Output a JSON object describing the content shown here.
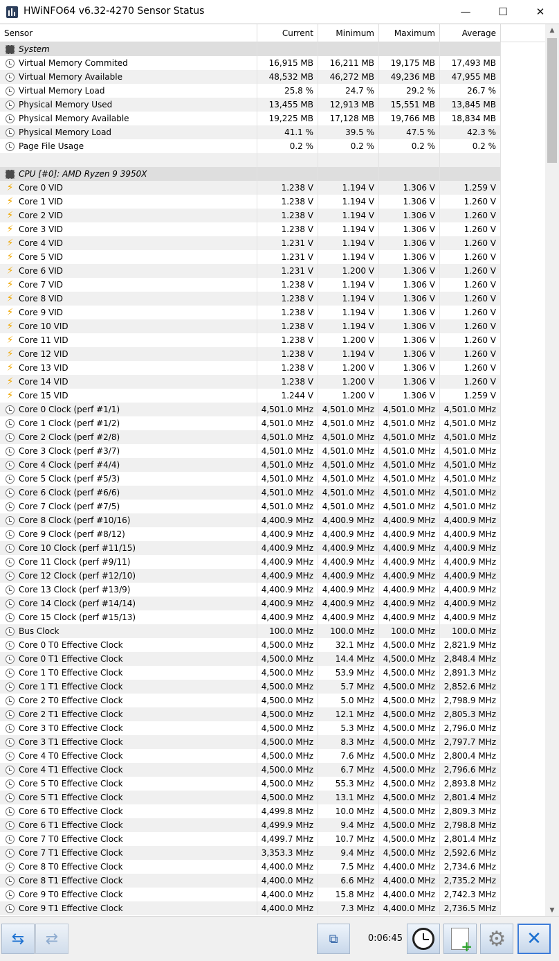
{
  "window": {
    "title": "HWiNFO64 v6.32-4270 Sensor Status",
    "minimize_glyph": "—",
    "maximize_glyph": "☐",
    "close_glyph": "✕"
  },
  "columns": {
    "sensor": "Sensor",
    "current": "Current",
    "minimum": "Minimum",
    "maximum": "Maximum",
    "average": "Average"
  },
  "rows": [
    {
      "type": "group",
      "icon": "chip-icon",
      "name": "System"
    },
    {
      "type": "sensor",
      "icon": "clock-icon",
      "name": "Virtual Memory Commited",
      "cur": "16,915 MB",
      "min": "16,211 MB",
      "max": "19,175 MB",
      "avg": "17,493 MB"
    },
    {
      "type": "sensor",
      "icon": "clock-icon",
      "name": "Virtual Memory Available",
      "cur": "48,532 MB",
      "min": "46,272 MB",
      "max": "49,236 MB",
      "avg": "47,955 MB"
    },
    {
      "type": "sensor",
      "icon": "clock-icon",
      "name": "Virtual Memory Load",
      "cur": "25.8 %",
      "min": "24.7 %",
      "max": "29.2 %",
      "avg": "26.7 %"
    },
    {
      "type": "sensor",
      "icon": "clock-icon",
      "name": "Physical Memory Used",
      "cur": "13,455 MB",
      "min": "12,913 MB",
      "max": "15,551 MB",
      "avg": "13,845 MB"
    },
    {
      "type": "sensor",
      "icon": "clock-icon",
      "name": "Physical Memory Available",
      "cur": "19,225 MB",
      "min": "17,128 MB",
      "max": "19,766 MB",
      "avg": "18,834 MB"
    },
    {
      "type": "sensor",
      "icon": "clock-icon",
      "name": "Physical Memory Load",
      "cur": "41.1 %",
      "min": "39.5 %",
      "max": "47.5 %",
      "avg": "42.3 %"
    },
    {
      "type": "sensor",
      "icon": "clock-icon",
      "name": "Page File Usage",
      "cur": "0.2 %",
      "min": "0.2 %",
      "max": "0.2 %",
      "avg": "0.2 %"
    },
    {
      "type": "blank"
    },
    {
      "type": "group",
      "icon": "chip-icon",
      "name": "CPU [#0]: AMD Ryzen 9 3950X"
    },
    {
      "type": "sensor",
      "icon": "voltage-icon",
      "name": "Core 0 VID",
      "cur": "1.238 V",
      "min": "1.194 V",
      "max": "1.306 V",
      "avg": "1.259 V"
    },
    {
      "type": "sensor",
      "icon": "voltage-icon",
      "name": "Core 1 VID",
      "cur": "1.238 V",
      "min": "1.194 V",
      "max": "1.306 V",
      "avg": "1.260 V"
    },
    {
      "type": "sensor",
      "icon": "voltage-icon",
      "name": "Core 2 VID",
      "cur": "1.238 V",
      "min": "1.194 V",
      "max": "1.306 V",
      "avg": "1.260 V"
    },
    {
      "type": "sensor",
      "icon": "voltage-icon",
      "name": "Core 3 VID",
      "cur": "1.238 V",
      "min": "1.194 V",
      "max": "1.306 V",
      "avg": "1.260 V"
    },
    {
      "type": "sensor",
      "icon": "voltage-icon",
      "name": "Core 4 VID",
      "cur": "1.231 V",
      "min": "1.194 V",
      "max": "1.306 V",
      "avg": "1.260 V"
    },
    {
      "type": "sensor",
      "icon": "voltage-icon",
      "name": "Core 5 VID",
      "cur": "1.231 V",
      "min": "1.194 V",
      "max": "1.306 V",
      "avg": "1.260 V"
    },
    {
      "type": "sensor",
      "icon": "voltage-icon",
      "name": "Core 6 VID",
      "cur": "1.231 V",
      "min": "1.200 V",
      "max": "1.306 V",
      "avg": "1.260 V"
    },
    {
      "type": "sensor",
      "icon": "voltage-icon",
      "name": "Core 7 VID",
      "cur": "1.238 V",
      "min": "1.194 V",
      "max": "1.306 V",
      "avg": "1.260 V"
    },
    {
      "type": "sensor",
      "icon": "voltage-icon",
      "name": "Core 8 VID",
      "cur": "1.238 V",
      "min": "1.194 V",
      "max": "1.306 V",
      "avg": "1.260 V"
    },
    {
      "type": "sensor",
      "icon": "voltage-icon",
      "name": "Core 9 VID",
      "cur": "1.238 V",
      "min": "1.194 V",
      "max": "1.306 V",
      "avg": "1.260 V"
    },
    {
      "type": "sensor",
      "icon": "voltage-icon",
      "name": "Core 10 VID",
      "cur": "1.238 V",
      "min": "1.194 V",
      "max": "1.306 V",
      "avg": "1.260 V"
    },
    {
      "type": "sensor",
      "icon": "voltage-icon",
      "name": "Core 11 VID",
      "cur": "1.238 V",
      "min": "1.200 V",
      "max": "1.306 V",
      "avg": "1.260 V"
    },
    {
      "type": "sensor",
      "icon": "voltage-icon",
      "name": "Core 12 VID",
      "cur": "1.238 V",
      "min": "1.194 V",
      "max": "1.306 V",
      "avg": "1.260 V"
    },
    {
      "type": "sensor",
      "icon": "voltage-icon",
      "name": "Core 13 VID",
      "cur": "1.238 V",
      "min": "1.200 V",
      "max": "1.306 V",
      "avg": "1.260 V"
    },
    {
      "type": "sensor",
      "icon": "voltage-icon",
      "name": "Core 14 VID",
      "cur": "1.238 V",
      "min": "1.200 V",
      "max": "1.306 V",
      "avg": "1.260 V"
    },
    {
      "type": "sensor",
      "icon": "voltage-icon",
      "name": "Core 15 VID",
      "cur": "1.244 V",
      "min": "1.200 V",
      "max": "1.306 V",
      "avg": "1.259 V"
    },
    {
      "type": "sensor",
      "icon": "clock-icon",
      "name": "Core 0 Clock (perf #1/1)",
      "cur": "4,501.0 MHz",
      "min": "4,501.0 MHz",
      "max": "4,501.0 MHz",
      "avg": "4,501.0 MHz"
    },
    {
      "type": "sensor",
      "icon": "clock-icon",
      "name": "Core 1 Clock (perf #1/2)",
      "cur": "4,501.0 MHz",
      "min": "4,501.0 MHz",
      "max": "4,501.0 MHz",
      "avg": "4,501.0 MHz"
    },
    {
      "type": "sensor",
      "icon": "clock-icon",
      "name": "Core 2 Clock (perf #2/8)",
      "cur": "4,501.0 MHz",
      "min": "4,501.0 MHz",
      "max": "4,501.0 MHz",
      "avg": "4,501.0 MHz"
    },
    {
      "type": "sensor",
      "icon": "clock-icon",
      "name": "Core 3 Clock (perf #3/7)",
      "cur": "4,501.0 MHz",
      "min": "4,501.0 MHz",
      "max": "4,501.0 MHz",
      "avg": "4,501.0 MHz"
    },
    {
      "type": "sensor",
      "icon": "clock-icon",
      "name": "Core 4 Clock (perf #4/4)",
      "cur": "4,501.0 MHz",
      "min": "4,501.0 MHz",
      "max": "4,501.0 MHz",
      "avg": "4,501.0 MHz"
    },
    {
      "type": "sensor",
      "icon": "clock-icon",
      "name": "Core 5 Clock (perf #5/3)",
      "cur": "4,501.0 MHz",
      "min": "4,501.0 MHz",
      "max": "4,501.0 MHz",
      "avg": "4,501.0 MHz"
    },
    {
      "type": "sensor",
      "icon": "clock-icon",
      "name": "Core 6 Clock (perf #6/6)",
      "cur": "4,501.0 MHz",
      "min": "4,501.0 MHz",
      "max": "4,501.0 MHz",
      "avg": "4,501.0 MHz"
    },
    {
      "type": "sensor",
      "icon": "clock-icon",
      "name": "Core 7 Clock (perf #7/5)",
      "cur": "4,501.0 MHz",
      "min": "4,501.0 MHz",
      "max": "4,501.0 MHz",
      "avg": "4,501.0 MHz"
    },
    {
      "type": "sensor",
      "icon": "clock-icon",
      "name": "Core 8 Clock (perf #10/16)",
      "cur": "4,400.9 MHz",
      "min": "4,400.9 MHz",
      "max": "4,400.9 MHz",
      "avg": "4,400.9 MHz"
    },
    {
      "type": "sensor",
      "icon": "clock-icon",
      "name": "Core 9 Clock (perf #8/12)",
      "cur": "4,400.9 MHz",
      "min": "4,400.9 MHz",
      "max": "4,400.9 MHz",
      "avg": "4,400.9 MHz"
    },
    {
      "type": "sensor",
      "icon": "clock-icon",
      "name": "Core 10 Clock (perf #11/15)",
      "cur": "4,400.9 MHz",
      "min": "4,400.9 MHz",
      "max": "4,400.9 MHz",
      "avg": "4,400.9 MHz"
    },
    {
      "type": "sensor",
      "icon": "clock-icon",
      "name": "Core 11 Clock (perf #9/11)",
      "cur": "4,400.9 MHz",
      "min": "4,400.9 MHz",
      "max": "4,400.9 MHz",
      "avg": "4,400.9 MHz"
    },
    {
      "type": "sensor",
      "icon": "clock-icon",
      "name": "Core 12 Clock (perf #12/10)",
      "cur": "4,400.9 MHz",
      "min": "4,400.9 MHz",
      "max": "4,400.9 MHz",
      "avg": "4,400.9 MHz"
    },
    {
      "type": "sensor",
      "icon": "clock-icon",
      "name": "Core 13 Clock (perf #13/9)",
      "cur": "4,400.9 MHz",
      "min": "4,400.9 MHz",
      "max": "4,400.9 MHz",
      "avg": "4,400.9 MHz"
    },
    {
      "type": "sensor",
      "icon": "clock-icon",
      "name": "Core 14 Clock (perf #14/14)",
      "cur": "4,400.9 MHz",
      "min": "4,400.9 MHz",
      "max": "4,400.9 MHz",
      "avg": "4,400.9 MHz"
    },
    {
      "type": "sensor",
      "icon": "clock-icon",
      "name": "Core 15 Clock (perf #15/13)",
      "cur": "4,400.9 MHz",
      "min": "4,400.9 MHz",
      "max": "4,400.9 MHz",
      "avg": "4,400.9 MHz"
    },
    {
      "type": "sensor",
      "icon": "clock-icon",
      "name": "Bus Clock",
      "cur": "100.0 MHz",
      "min": "100.0 MHz",
      "max": "100.0 MHz",
      "avg": "100.0 MHz"
    },
    {
      "type": "sensor",
      "icon": "clock-icon",
      "name": "Core 0 T0 Effective Clock",
      "cur": "4,500.0 MHz",
      "min": "32.1 MHz",
      "max": "4,500.0 MHz",
      "avg": "2,821.9 MHz"
    },
    {
      "type": "sensor",
      "icon": "clock-icon",
      "name": "Core 0 T1 Effective Clock",
      "cur": "4,500.0 MHz",
      "min": "14.4 MHz",
      "max": "4,500.0 MHz",
      "avg": "2,848.4 MHz"
    },
    {
      "type": "sensor",
      "icon": "clock-icon",
      "name": "Core 1 T0 Effective Clock",
      "cur": "4,500.0 MHz",
      "min": "53.9 MHz",
      "max": "4,500.0 MHz",
      "avg": "2,891.3 MHz"
    },
    {
      "type": "sensor",
      "icon": "clock-icon",
      "name": "Core 1 T1 Effective Clock",
      "cur": "4,500.0 MHz",
      "min": "5.7 MHz",
      "max": "4,500.0 MHz",
      "avg": "2,852.6 MHz"
    },
    {
      "type": "sensor",
      "icon": "clock-icon",
      "name": "Core 2 T0 Effective Clock",
      "cur": "4,500.0 MHz",
      "min": "5.0 MHz",
      "max": "4,500.0 MHz",
      "avg": "2,798.9 MHz"
    },
    {
      "type": "sensor",
      "icon": "clock-icon",
      "name": "Core 2 T1 Effective Clock",
      "cur": "4,500.0 MHz",
      "min": "12.1 MHz",
      "max": "4,500.0 MHz",
      "avg": "2,805.3 MHz"
    },
    {
      "type": "sensor",
      "icon": "clock-icon",
      "name": "Core 3 T0 Effective Clock",
      "cur": "4,500.0 MHz",
      "min": "5.3 MHz",
      "max": "4,500.0 MHz",
      "avg": "2,796.0 MHz"
    },
    {
      "type": "sensor",
      "icon": "clock-icon",
      "name": "Core 3 T1 Effective Clock",
      "cur": "4,500.0 MHz",
      "min": "8.3 MHz",
      "max": "4,500.0 MHz",
      "avg": "2,797.7 MHz"
    },
    {
      "type": "sensor",
      "icon": "clock-icon",
      "name": "Core 4 T0 Effective Clock",
      "cur": "4,500.0 MHz",
      "min": "7.6 MHz",
      "max": "4,500.0 MHz",
      "avg": "2,800.4 MHz"
    },
    {
      "type": "sensor",
      "icon": "clock-icon",
      "name": "Core 4 T1 Effective Clock",
      "cur": "4,500.0 MHz",
      "min": "6.7 MHz",
      "max": "4,500.0 MHz",
      "avg": "2,796.6 MHz"
    },
    {
      "type": "sensor",
      "icon": "clock-icon",
      "name": "Core 5 T0 Effective Clock",
      "cur": "4,500.0 MHz",
      "min": "55.3 MHz",
      "max": "4,500.0 MHz",
      "avg": "2,893.8 MHz"
    },
    {
      "type": "sensor",
      "icon": "clock-icon",
      "name": "Core 5 T1 Effective Clock",
      "cur": "4,500.0 MHz",
      "min": "13.1 MHz",
      "max": "4,500.0 MHz",
      "avg": "2,801.4 MHz"
    },
    {
      "type": "sensor",
      "icon": "clock-icon",
      "name": "Core 6 T0 Effective Clock",
      "cur": "4,499.8 MHz",
      "min": "10.0 MHz",
      "max": "4,500.0 MHz",
      "avg": "2,809.3 MHz"
    },
    {
      "type": "sensor",
      "icon": "clock-icon",
      "name": "Core 6 T1 Effective Clock",
      "cur": "4,499.9 MHz",
      "min": "9.4 MHz",
      "max": "4,500.0 MHz",
      "avg": "2,798.8 MHz"
    },
    {
      "type": "sensor",
      "icon": "clock-icon",
      "name": "Core 7 T0 Effective Clock",
      "cur": "4,499.7 MHz",
      "min": "10.7 MHz",
      "max": "4,500.0 MHz",
      "avg": "2,801.4 MHz"
    },
    {
      "type": "sensor",
      "icon": "clock-icon",
      "name": "Core 7 T1 Effective Clock",
      "cur": "3,353.3 MHz",
      "min": "9.4 MHz",
      "max": "4,500.0 MHz",
      "avg": "2,592.6 MHz"
    },
    {
      "type": "sensor",
      "icon": "clock-icon",
      "name": "Core 8 T0 Effective Clock",
      "cur": "4,400.0 MHz",
      "min": "7.5 MHz",
      "max": "4,400.0 MHz",
      "avg": "2,734.6 MHz"
    },
    {
      "type": "sensor",
      "icon": "clock-icon",
      "name": "Core 8 T1 Effective Clock",
      "cur": "4,400.0 MHz",
      "min": "6.6 MHz",
      "max": "4,400.0 MHz",
      "avg": "2,735.2 MHz"
    },
    {
      "type": "sensor",
      "icon": "clock-icon",
      "name": "Core 9 T0 Effective Clock",
      "cur": "4,400.0 MHz",
      "min": "15.8 MHz",
      "max": "4,400.0 MHz",
      "avg": "2,742.3 MHz"
    },
    {
      "type": "sensor",
      "icon": "clock-icon",
      "name": "Core 9 T1 Effective Clock",
      "cur": "4,400.0 MHz",
      "min": "7.3 MHz",
      "max": "4,400.0 MHz",
      "avg": "2,736.5 MHz"
    }
  ],
  "toolbar": {
    "nav_left_glyph": "⇆",
    "nav_right_glyph": "⇄",
    "network_glyph": "⧉",
    "elapsed_time": "0:06:45",
    "settings_glyph": "⚙",
    "exit_glyph": "✕"
  },
  "scrollbar": {
    "up_glyph": "▲",
    "down_glyph": "▼"
  }
}
